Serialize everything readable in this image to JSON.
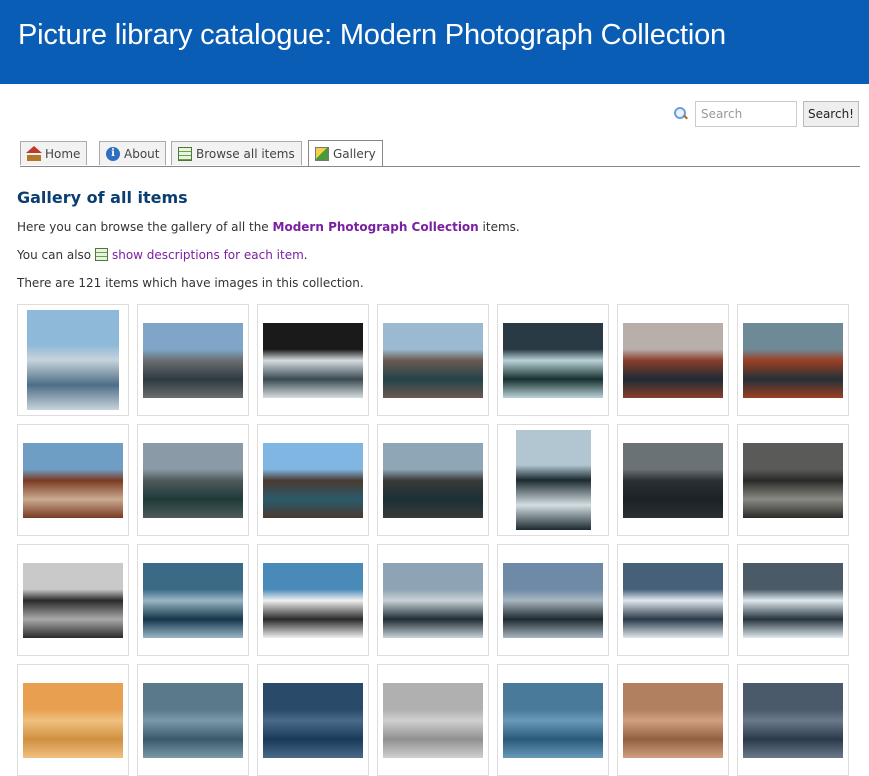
{
  "header": {
    "title": "Picture library catalogue: Modern Photograph Collection"
  },
  "search": {
    "placeholder": "Search",
    "button_label": "Search!"
  },
  "tabs": [
    {
      "label": "Home",
      "icon": "home-icon"
    },
    {
      "label": "About",
      "icon": "info-icon"
    },
    {
      "label": "Browse all items",
      "icon": "browse-icon"
    },
    {
      "label": "Gallery",
      "icon": "gallery-icon",
      "active": true
    }
  ],
  "main": {
    "heading": "Gallery of all items",
    "intro_prefix": "Here you can browse the gallery of all the ",
    "collection_name": "Modern Photograph Collection",
    "intro_suffix": " items.",
    "also_prefix": "You can also ",
    "also_link": "show descriptions for each item",
    "also_suffix": ".",
    "count_text": "There are 121 items which have images in this collection."
  },
  "gallery": {
    "thumbnails": [
      {
        "name": "glacier-fjord-reflection",
        "colors": [
          "#8fb9d8",
          "#c7d4dc",
          "#4e6e86"
        ]
      },
      {
        "name": "mountain-glacier-front",
        "colors": [
          "#7fa6c8",
          "#6a6e70",
          "#2d3a40"
        ]
      },
      {
        "name": "ice-cliff-reflection",
        "colors": [
          "#1a1a1a",
          "#d6dde0",
          "#3a4a50"
        ]
      },
      {
        "name": "glacier-valley-fjord",
        "colors": [
          "#9bbad2",
          "#6a5a50",
          "#24424a"
        ]
      },
      {
        "name": "icebergs-dark-water",
        "colors": [
          "#2a3a44",
          "#b9d3d9",
          "#16302e"
        ]
      },
      {
        "name": "sunset-peaks-reflection",
        "colors": [
          "#b8aeaa",
          "#8a3e2a",
          "#1f2a34"
        ]
      },
      {
        "name": "red-peaks-water",
        "colors": [
          "#6e8a96",
          "#9c3f22",
          "#243038"
        ]
      },
      {
        "name": "red-mountain-sky",
        "colors": [
          "#6f9ec4",
          "#7a3a22",
          "#c9ab90"
        ]
      },
      {
        "name": "cloudy-glacier-fjord",
        "colors": [
          "#8a9aa6",
          "#4f5a5a",
          "#1f3a3a"
        ]
      },
      {
        "name": "blue-sky-fjord",
        "colors": [
          "#7fb6e2",
          "#4a3a30",
          "#2b5a6a"
        ]
      },
      {
        "name": "ice-floes-mountains",
        "colors": [
          "#8fa6b6",
          "#3a3a3a",
          "#1a3036"
        ]
      },
      {
        "name": "sea-ice-pieces",
        "colors": [
          "#b2c6d2",
          "#1b2a30",
          "#d4dee2"
        ]
      },
      {
        "name": "stormy-sea",
        "colors": [
          "#6b7276",
          "#2a3034",
          "#1b2226"
        ]
      },
      {
        "name": "lichen-rocks",
        "colors": [
          "#5a5a58",
          "#2a2a28",
          "#8a8a84"
        ]
      },
      {
        "name": "penguins-line",
        "colors": [
          "#c9c9c9",
          "#2a2a2a",
          "#a9a9a9"
        ]
      },
      {
        "name": "whale-surfacing",
        "colors": [
          "#3a6a86",
          "#9ab6c6",
          "#14364a"
        ]
      },
      {
        "name": "seal-on-ice",
        "colors": [
          "#4a8ab8",
          "#f0f0f0",
          "#2a2a2a"
        ]
      },
      {
        "name": "iceberg-field",
        "colors": [
          "#8da4b4",
          "#c8d2d8",
          "#1f2e34"
        ]
      },
      {
        "name": "cloud-layers-ice",
        "colors": [
          "#6f8aa6",
          "#a8b6c0",
          "#1f2a30"
        ]
      },
      {
        "name": "streaked-clouds",
        "colors": [
          "#46607a",
          "#e0e8ee",
          "#2a3a48"
        ]
      },
      {
        "name": "tabular-iceberg",
        "colors": [
          "#4a5a66",
          "#dfe9ee",
          "#26343e"
        ]
      },
      {
        "name": "row4-1",
        "colors": [
          "#e8a050",
          "#f0c080",
          "#d09040"
        ]
      },
      {
        "name": "row4-2",
        "colors": [
          "#5a7a8a",
          "#7a9aaa",
          "#3a5a6a"
        ]
      },
      {
        "name": "row4-3",
        "colors": [
          "#2a4a6a",
          "#4a6a8a",
          "#1a3a5a"
        ]
      },
      {
        "name": "row4-4",
        "colors": [
          "#b0b0b0",
          "#d0d0d0",
          "#909090"
        ]
      },
      {
        "name": "row4-5",
        "colors": [
          "#4a7a9a",
          "#6a9aba",
          "#2a5a7a"
        ]
      },
      {
        "name": "row4-6",
        "colors": [
          "#b08060",
          "#d0a080",
          "#906040"
        ]
      },
      {
        "name": "row4-7",
        "colors": [
          "#4a5a6a",
          "#6a7a8a",
          "#2a3a4a"
        ]
      }
    ]
  }
}
